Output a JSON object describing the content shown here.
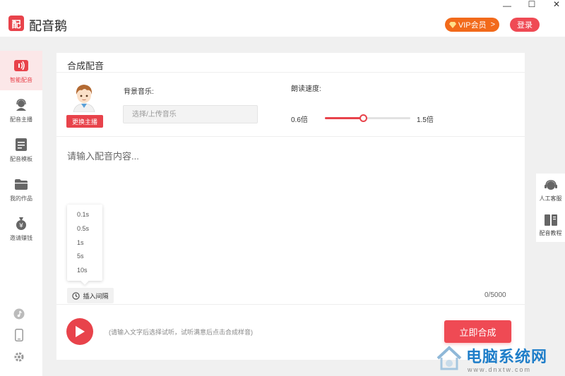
{
  "app": {
    "logo_text": "配",
    "name": "配音鹅",
    "vip_label": "VIP会员",
    "vip_arrow": ">",
    "login_label": "登录",
    "window_controls": {
      "minimize": "—",
      "maximize": "☐",
      "close": "✕"
    }
  },
  "sidebar": {
    "items": [
      {
        "label": "智能配音",
        "icon": "voice-icon",
        "active": true
      },
      {
        "label": "配音主播",
        "icon": "headset-icon",
        "active": false
      },
      {
        "label": "配音模板",
        "icon": "template-icon",
        "active": false
      },
      {
        "label": "我的作品",
        "icon": "folder-icon",
        "active": false
      },
      {
        "label": "邀请赚钱",
        "icon": "money-bag-icon",
        "active": false
      }
    ],
    "bottom_icons": [
      "music-note-icon",
      "phone-icon",
      "gear-icon"
    ]
  },
  "main": {
    "title": "合成配音",
    "change_anchor_label": "更换主播",
    "bg_music_label": "背景音乐:",
    "bg_music_placeholder": "选择/上传音乐",
    "speed_label": "朗读速度:",
    "speed_min": "0.6倍",
    "speed_max": "1.5倍",
    "speed_level": 0.45,
    "content_placeholder": "请输入配音内容...",
    "pause_options": [
      "0.1s",
      "0.5s",
      "1s",
      "5s",
      "10s"
    ],
    "insert_pause_label": "插入间隔",
    "char_count": "0/5000",
    "hint": "(请输入文字后选择试听，试听满意后点击合成样音)",
    "synthesize_label": "立即合成"
  },
  "right_panel": {
    "items": [
      {
        "label": "人工客服",
        "icon": "customer-service-icon"
      },
      {
        "label": "配音教程",
        "icon": "tutorial-book-icon"
      }
    ]
  },
  "watermark": {
    "title": "电脑系统网",
    "url": "www.dnxtw.com"
  },
  "colors": {
    "accent": "#e8434b",
    "vip": "#f26a1b",
    "watermark_blue": "#1f7ec9"
  }
}
